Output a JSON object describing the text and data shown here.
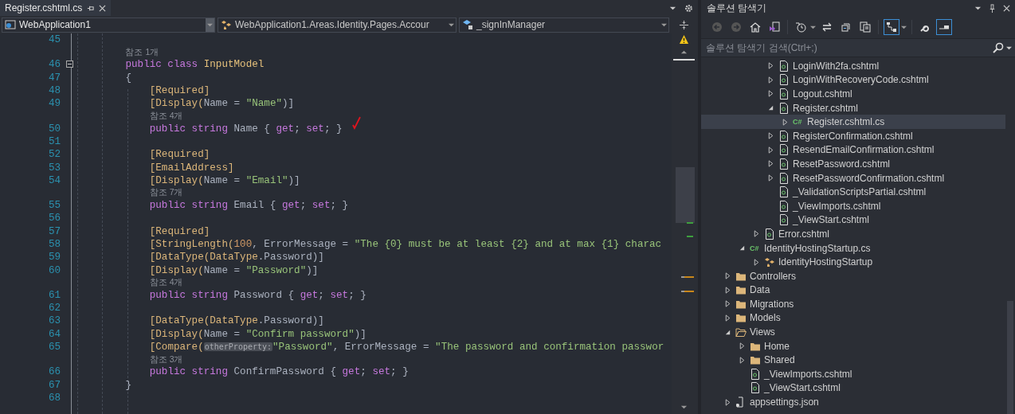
{
  "editor": {
    "tab": {
      "label": "Register.cshtml.cs",
      "selected": true
    },
    "nav": [
      {
        "kind": "project",
        "text": "WebApplication1"
      },
      {
        "kind": "class",
        "text": "WebApplication1.Areas.Identity.Pages.Accour"
      },
      {
        "kind": "field",
        "text": "_signInManager"
      }
    ],
    "lines": [
      {
        "kind": "code",
        "number": "45"
      },
      {
        "kind": "lens",
        "text": "        참조 1개"
      },
      {
        "kind": "code",
        "number": "46",
        "expanded": true,
        "tokens": [
          {
            "kind": "kw",
            "text": "        public class"
          },
          {
            "kind": "type",
            "text": " InputModel"
          }
        ]
      },
      {
        "kind": "code",
        "number": "47",
        "tokens": [
          {
            "kind": "p",
            "text": "        {"
          }
        ]
      },
      {
        "kind": "code",
        "number": "48",
        "tokens": [
          {
            "kind": "attr",
            "text": "            [Required]"
          }
        ]
      },
      {
        "kind": "code",
        "number": "49",
        "tokens": [
          {
            "kind": "attr",
            "text": "            [Display("
          },
          {
            "kind": "p",
            "text": "Name = "
          },
          {
            "kind": "str",
            "text": "\"Name\""
          },
          {
            "kind": "p",
            "text": ")]"
          }
        ]
      },
      {
        "kind": "lens",
        "text": "            참조 4개"
      },
      {
        "kind": "code",
        "number": "50",
        "tokens": [
          {
            "kind": "kw",
            "text": "            public string"
          },
          {
            "kind": "p",
            "text": " Name { "
          },
          {
            "kind": "kw",
            "text": "get"
          },
          {
            "kind": "p",
            "text": "; "
          },
          {
            "kind": "kw",
            "text": "set"
          },
          {
            "kind": "p",
            "text": "; }"
          }
        ]
      },
      {
        "kind": "code",
        "number": "51"
      },
      {
        "kind": "code",
        "number": "52",
        "tokens": [
          {
            "kind": "attr",
            "text": "            [Required]"
          }
        ]
      },
      {
        "kind": "code",
        "number": "53",
        "tokens": [
          {
            "kind": "attr",
            "text": "            [EmailAddress]"
          }
        ]
      },
      {
        "kind": "code",
        "number": "54",
        "tokens": [
          {
            "kind": "attr",
            "text": "            [Display("
          },
          {
            "kind": "p",
            "text": "Name = "
          },
          {
            "kind": "str",
            "text": "\"Email\""
          },
          {
            "kind": "p",
            "text": ")]"
          }
        ]
      },
      {
        "kind": "lens",
        "text": "            참조 7개"
      },
      {
        "kind": "code",
        "number": "55",
        "tokens": [
          {
            "kind": "kw",
            "text": "            public string"
          },
          {
            "kind": "p",
            "text": " Email { "
          },
          {
            "kind": "kw",
            "text": "get"
          },
          {
            "kind": "p",
            "text": "; "
          },
          {
            "kind": "kw",
            "text": "set"
          },
          {
            "kind": "p",
            "text": "; }"
          }
        ]
      },
      {
        "kind": "code",
        "number": "56"
      },
      {
        "kind": "code",
        "number": "57",
        "tokens": [
          {
            "kind": "attr",
            "text": "            [Required]"
          }
        ]
      },
      {
        "kind": "code",
        "number": "58",
        "tokens": [
          {
            "kind": "attr",
            "text": "            [StringLength("
          },
          {
            "kind": "num",
            "text": "100"
          },
          {
            "kind": "p",
            "text": ", ErrorMessage = "
          },
          {
            "kind": "str",
            "text": "\"The {0} must be at least {2} and at max {1} charac"
          }
        ]
      },
      {
        "kind": "code",
        "number": "59",
        "tokens": [
          {
            "kind": "attr",
            "text": "            [DataType(DataType"
          },
          {
            "kind": "p",
            "text": ".Password)]"
          }
        ]
      },
      {
        "kind": "code",
        "number": "60",
        "tokens": [
          {
            "kind": "attr",
            "text": "            [Display("
          },
          {
            "kind": "p",
            "text": "Name = "
          },
          {
            "kind": "str",
            "text": "\"Password\""
          },
          {
            "kind": "p",
            "text": ")]"
          }
        ]
      },
      {
        "kind": "lens",
        "text": "            참조 4개"
      },
      {
        "kind": "code",
        "number": "61",
        "tokens": [
          {
            "kind": "kw",
            "text": "            public string"
          },
          {
            "kind": "p",
            "text": " Password { "
          },
          {
            "kind": "kw",
            "text": "get"
          },
          {
            "kind": "p",
            "text": "; "
          },
          {
            "kind": "kw",
            "text": "set"
          },
          {
            "kind": "p",
            "text": "; }"
          }
        ]
      },
      {
        "kind": "code",
        "number": "62"
      },
      {
        "kind": "code",
        "number": "63",
        "tokens": [
          {
            "kind": "attr",
            "text": "            [DataType(DataType"
          },
          {
            "kind": "p",
            "text": ".Password)]"
          }
        ]
      },
      {
        "kind": "code",
        "number": "64",
        "tokens": [
          {
            "kind": "attr",
            "text": "            [Display("
          },
          {
            "kind": "p",
            "text": "Name = "
          },
          {
            "kind": "str",
            "text": "\"Confirm password\""
          },
          {
            "kind": "p",
            "text": ")]"
          }
        ]
      },
      {
        "kind": "code",
        "number": "65",
        "tokens": [
          {
            "kind": "attr",
            "text": "            [Compare("
          },
          {
            "kind": "hint",
            "text": "otherProperty:"
          },
          {
            "kind": "str",
            "text": "\"Password\""
          },
          {
            "kind": "p",
            "text": ", ErrorMessage = "
          },
          {
            "kind": "str",
            "text": "\"The password and confirmation passwor"
          }
        ]
      },
      {
        "kind": "lens",
        "text": "            참조 3개"
      },
      {
        "kind": "code",
        "number": "66",
        "tokens": [
          {
            "kind": "kw",
            "text": "            public string"
          },
          {
            "kind": "p",
            "text": " ConfirmPassword { "
          },
          {
            "kind": "kw",
            "text": "get"
          },
          {
            "kind": "p",
            "text": "; "
          },
          {
            "kind": "kw",
            "text": "set"
          },
          {
            "kind": "p",
            "text": "; }"
          }
        ]
      },
      {
        "kind": "code",
        "number": "67",
        "tokens": [
          {
            "kind": "p",
            "text": "        }"
          }
        ]
      },
      {
        "kind": "code",
        "number": "68"
      }
    ]
  },
  "explorer": {
    "title": "솔루션 탐색기",
    "toolbar": [
      {
        "kind": "back",
        "on": false
      },
      {
        "kind": "forward",
        "on": false
      },
      {
        "kind": "home",
        "on": false
      },
      {
        "kind": "solution",
        "on": false
      },
      {
        "kind": "history",
        "on": false
      },
      {
        "kind": "sync",
        "on": false
      },
      {
        "kind": "collapse",
        "on": false
      },
      {
        "kind": "pages",
        "on": false
      },
      {
        "kind": "showall",
        "on": true
      },
      {
        "kind": "wrench",
        "on": false
      },
      {
        "kind": "preview",
        "on": true
      }
    ],
    "search": {
      "placeholder": "솔루션 탐색기 검색(Ctrl+;)"
    },
    "tree": [
      {
        "children": [
          {
            "children": [
              {
                "children": [
                  {
                    "label": "LoginWith2fa.cshtml",
                    "kind": "razor",
                    "expanded": false,
                    "selected": false
                  },
                  {
                    "label": "LoginWithRecoveryCode.cshtml",
                    "kind": "razor",
                    "expanded": false,
                    "selected": false
                  },
                  {
                    "label": "Logout.cshtml",
                    "kind": "razor",
                    "expanded": false,
                    "selected": false
                  },
                  {
                    "label": "Register.cshtml",
                    "kind": "razor",
                    "expanded": true,
                    "selected": false,
                    "children": [
                      {
                        "label": "Register.cshtml.cs",
                        "kind": "csharp",
                        "badge": "C#",
                        "expanded": false,
                        "selected": true
                      }
                    ]
                  },
                  {
                    "label": "RegisterConfirmation.cshtml",
                    "kind": "razor",
                    "expanded": false,
                    "selected": false
                  },
                  {
                    "label": "ResendEmailConfirmation.cshtml",
                    "kind": "razor",
                    "expanded": false,
                    "selected": false
                  },
                  {
                    "label": "ResetPassword.cshtml",
                    "kind": "razor",
                    "expanded": false,
                    "selected": false
                  },
                  {
                    "label": "ResetPasswordConfirmation.cshtml",
                    "kind": "razor",
                    "expanded": false,
                    "selected": false
                  },
                  {
                    "label": "_ValidationScriptsPartial.cshtml",
                    "kind": "razor",
                    "selected": false
                  },
                  {
                    "label": "_ViewImports.cshtml",
                    "kind": "razor",
                    "selected": false
                  },
                  {
                    "label": "_ViewStart.cshtml",
                    "kind": "razor",
                    "selected": false
                  }
                ]
              },
              {
                "label": "Error.cshtml",
                "kind": "razor",
                "expanded": false,
                "selected": false
              }
            ]
          },
          {
            "label": "IdentityHostingStartup.cs",
            "kind": "csharp",
            "badge": "C#",
            "expanded": true,
            "selected": false,
            "children": [
              {
                "label": "IdentityHostingStartup",
                "kind": "class",
                "expanded": false,
                "selected": false
              }
            ]
          }
        ]
      },
      {
        "label": "Controllers",
        "kind": "folder",
        "expanded": false,
        "selected": false
      },
      {
        "label": "Data",
        "kind": "folder",
        "expanded": false,
        "selected": false
      },
      {
        "label": "Migrations",
        "kind": "folder",
        "expanded": false,
        "selected": false
      },
      {
        "label": "Models",
        "kind": "folder",
        "expanded": false,
        "selected": false
      },
      {
        "label": "Views",
        "kind": "folder",
        "expanded": true,
        "selected": false,
        "children": [
          {
            "label": "Home",
            "kind": "folder",
            "expanded": false,
            "selected": false
          },
          {
            "label": "Shared",
            "kind": "folder",
            "expanded": false,
            "selected": false
          },
          {
            "label": "_ViewImports.cshtml",
            "kind": "razor",
            "selected": false
          },
          {
            "label": "_ViewStart.cshtml",
            "kind": "razor",
            "selected": false
          }
        ]
      },
      {
        "label": "appsettings.json",
        "kind": "json",
        "expanded": false,
        "selected": false
      }
    ]
  }
}
